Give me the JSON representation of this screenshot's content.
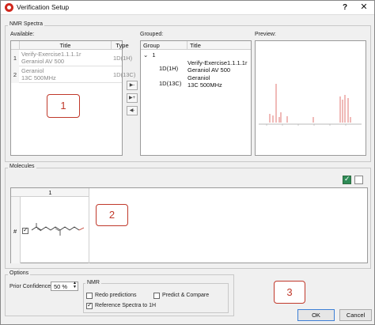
{
  "window": {
    "title": "Verification Setup",
    "help": "?",
    "close": "✕"
  },
  "nmr_group": {
    "label": "NMR Spectra",
    "available_label": "Available:",
    "grouped_label": "Grouped:",
    "preview_label": "Preview:",
    "available_columns": [
      "Title",
      "Type"
    ],
    "available_rows": [
      {
        "num": "1",
        "title_line1": "Verify-Exercise1.1.1.1r",
        "title_line2": "Geraniol AV 500",
        "type": "1D(1H)"
      },
      {
        "num": "2",
        "title_line1": "Geraniol",
        "title_line2": "13C 500MHz",
        "type": "1D(13C)"
      }
    ],
    "arrow_buttons": [
      {
        "label": "▶-",
        "icon": "move-right-icon"
      },
      {
        "label": "▶+",
        "icon": "move-right-plus-icon"
      },
      {
        "label": "◀-",
        "icon": "move-left-icon"
      }
    ],
    "grouped_columns": [
      "Group",
      "Title"
    ],
    "group": {
      "id": "1",
      "rows": [
        {
          "type": "1D(1H)",
          "title_line1": "Verify-Exercise1.1.1.1r",
          "title_line2": "Geraniol AV 500"
        },
        {
          "type": "1D(13C)",
          "title_line1": "Geraniol",
          "title_line2": "13C 500MHz"
        }
      ]
    }
  },
  "molecules_group": {
    "label": "Molecules",
    "column_header": "1",
    "row_label": "#"
  },
  "options_group": {
    "label": "Options",
    "prior_confidence_label": "Prior Confidence:",
    "prior_confidence_value": "50 %",
    "nmr_label": "NMR",
    "redo_predictions": "Redo predictions",
    "predict_compare": "Predict & Compare",
    "reference_spectra": "Reference Spectra to 1H"
  },
  "markers": [
    "1",
    "2",
    "3"
  ],
  "buttons": {
    "ok": "OK",
    "cancel": "Cancel"
  },
  "colors": {
    "accent_red": "#c0392b",
    "spectrum_red": "#d9534f",
    "ok_border": "#3c7fd6",
    "check_green": "#2e8b57"
  }
}
